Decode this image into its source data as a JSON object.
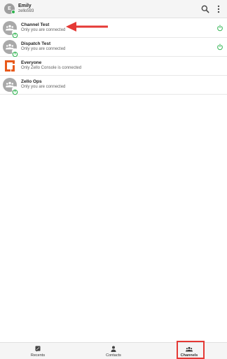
{
  "header": {
    "user_initial": "E",
    "user_name": "Emily",
    "user_id": "zello593"
  },
  "channels": [
    {
      "name": "Channel Test",
      "status": "Only you are connected",
      "avatar": "group-avatar",
      "power": true
    },
    {
      "name": "Dispatch Test",
      "status": "Only you are connected",
      "avatar": "group-avatar",
      "power": true
    },
    {
      "name": "Everyone",
      "status": "Only Zello Console is connected",
      "avatar": "zello-logo",
      "power": false
    },
    {
      "name": "Zello Ops",
      "status": "Only you are connected",
      "avatar": "group-avatar",
      "power": false
    }
  ],
  "bottom_nav": {
    "tabs": [
      {
        "label": "Recents",
        "icon": "recents-icon"
      },
      {
        "label": "Contacts",
        "icon": "contacts-icon"
      },
      {
        "label": "Channels",
        "icon": "channels-icon",
        "active": true
      }
    ]
  },
  "colors": {
    "accent_green": "#2bb24c",
    "annotation_red": "#e53935",
    "zello_orange": "#e8591a"
  }
}
